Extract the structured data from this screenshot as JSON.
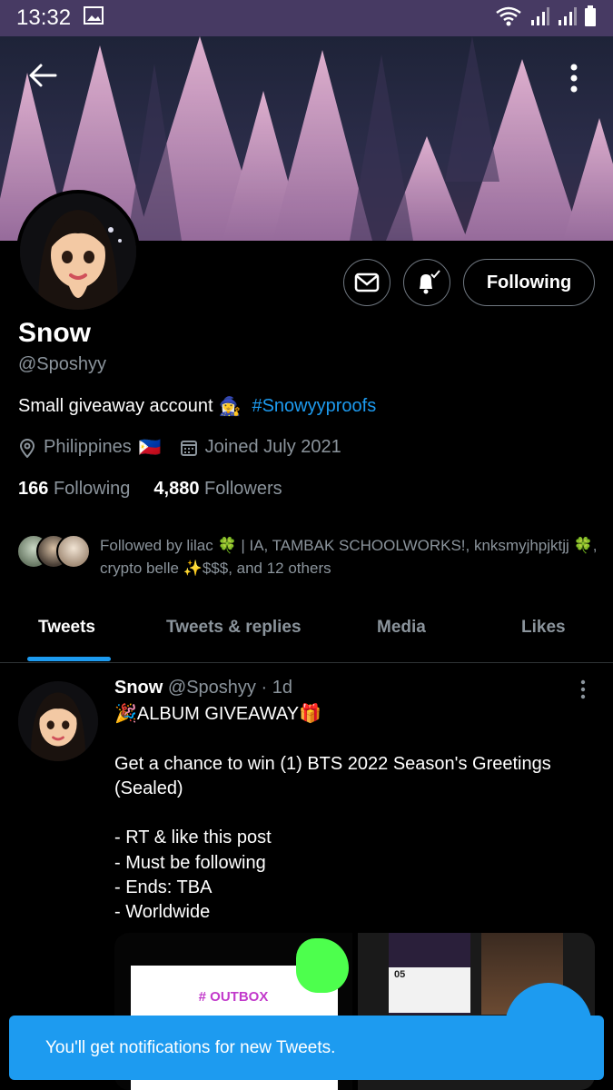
{
  "status_bar": {
    "time": "13:32",
    "icons": [
      "gallery-icon",
      "wifi-icon",
      "signal-icon",
      "signal-icon",
      "battery-icon"
    ]
  },
  "profile": {
    "name": "Snow",
    "handle": "@Sposhyy",
    "bio_text": "Small giveaway account",
    "bio_emoji": "🧙‍♀️",
    "bio_hashtag": "#Snowyyproofs",
    "location": "Philippines",
    "location_flag": "🇵🇭",
    "joined": "Joined July 2021",
    "following_count": "166",
    "following_label": "Following",
    "followers_count": "4,880",
    "followers_label": "Followers",
    "follow_button_label": "Following",
    "followed_by": "Followed by lilac 🍀 | IA, TAMBAK SCHOOLWORKS!, knksmyjhpjktjj 🍀, crypto belle ✨$$$, and 12 others"
  },
  "tabs": [
    {
      "label": "Tweets",
      "active": true
    },
    {
      "label": "Tweets & replies",
      "active": false
    },
    {
      "label": "Media",
      "active": false
    },
    {
      "label": "Likes",
      "active": false
    }
  ],
  "tweet": {
    "author_name": "Snow",
    "author_handle": "@Sposhyy",
    "time": "· 1d",
    "lines": [
      "🎉ALBUM GIVEAWAY🎁",
      "",
      "Get a chance to win (1) BTS 2022 Season's Greetings (Sealed)",
      "",
      "- RT & like this post",
      "- Must be following",
      "- Ends: TBA",
      "- Worldwide"
    ],
    "media_caption": "# OUTBOX",
    "media_date": "05"
  },
  "toast": "You'll get notifications for new Tweets.",
  "colors": {
    "accent": "#1d9bf0",
    "secondary_text": "#8b949c",
    "border": "#2f3336",
    "status_bar": "#473a63",
    "banner_tree": "#c08fb8"
  }
}
